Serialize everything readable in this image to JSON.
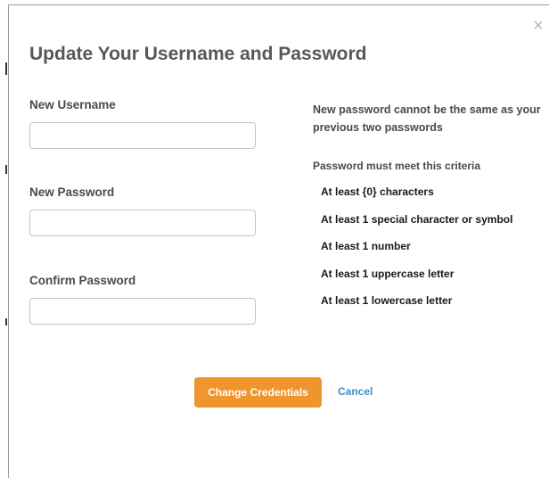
{
  "dialog": {
    "title": "Update Your Username and Password",
    "close_icon": "close-icon"
  },
  "form": {
    "username": {
      "label": "New Username",
      "value": "",
      "placeholder": ""
    },
    "password": {
      "label": "New Password",
      "value": "",
      "placeholder": ""
    },
    "confirm_password": {
      "label": "Confirm Password",
      "value": "",
      "placeholder": ""
    }
  },
  "rules": {
    "note": "New password cannot be the same as your previous two passwords",
    "criteria_heading": "Password must meet this criteria",
    "criteria": [
      "At least {0} characters",
      "At least 1 special character or symbol",
      "At least 1 number",
      "At least 1 uppercase letter",
      "At least 1 lowercase letter"
    ]
  },
  "actions": {
    "submit_label": "Change Credentials",
    "cancel_label": "Cancel"
  },
  "colors": {
    "primary_button": "#f0952e",
    "link": "#3a8fd0",
    "title": "#585858"
  }
}
